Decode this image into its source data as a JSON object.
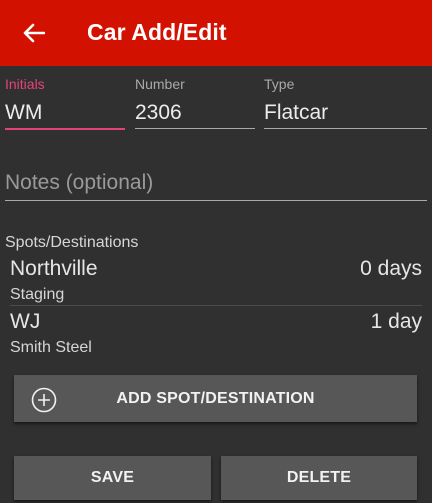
{
  "appbar": {
    "title": "Car Add/Edit",
    "back_icon": "arrow-left-icon",
    "color": "#d31100"
  },
  "fields": {
    "initials": {
      "label": "Initials",
      "value": "WM"
    },
    "number": {
      "label": "Number",
      "value": "2306"
    },
    "type": {
      "label": "Type",
      "value": "Flatcar"
    },
    "notes": {
      "placeholder": "Notes (optional)",
      "value": ""
    }
  },
  "spots": {
    "label": "Spots/Destinations",
    "items": [
      {
        "name": "Northville",
        "track": "Staging",
        "days": "0 days"
      },
      {
        "name": "WJ",
        "track": "Smith Steel",
        "days": "1 day"
      }
    ]
  },
  "buttons": {
    "add_spot": "ADD SPOT/DESTINATION",
    "add_icon": "add-circle-icon",
    "save": "SAVE",
    "delete": "DELETE"
  },
  "colors": {
    "accent": "#e54377",
    "background": "#303030",
    "button": "#575757"
  }
}
